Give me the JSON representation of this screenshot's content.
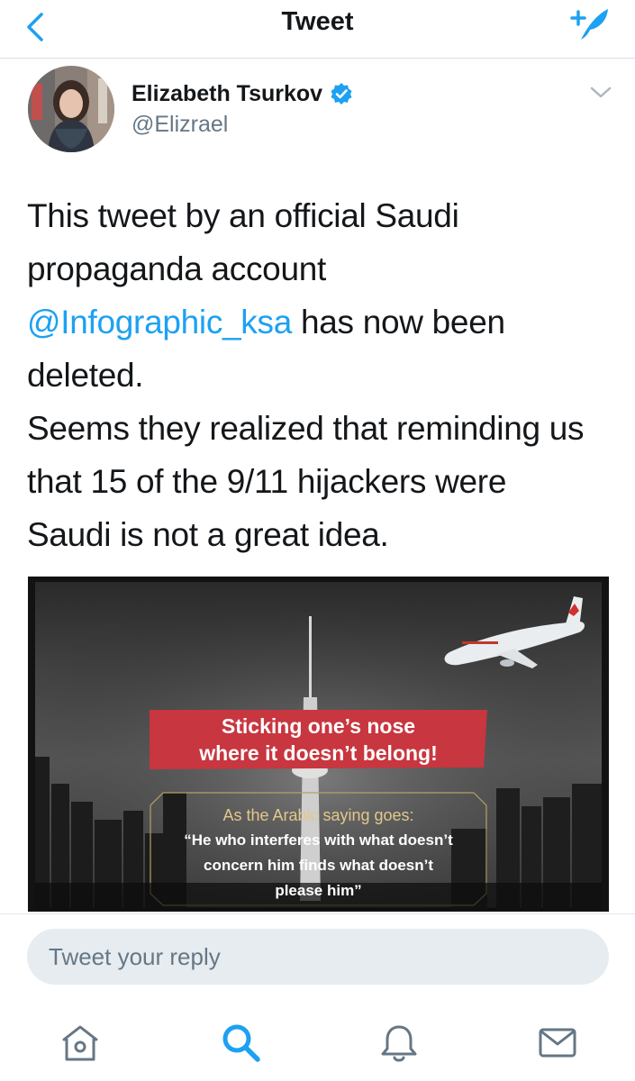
{
  "header": {
    "title": "Tweet",
    "back_icon": "chevron-left-icon",
    "compose_icon": "compose-tweet-icon",
    "accent": "#1da1f2"
  },
  "tweet": {
    "author_name": "Elizabeth Tsurkov",
    "handle": "@Elizrael",
    "verified": true,
    "lines": [
      {
        "text": "This tweet by an official Saudi"
      },
      {
        "text": "propaganda account"
      },
      {
        "mention": "@Infographic_ksa",
        "text": " has now been"
      },
      {
        "text": "deleted."
      },
      {
        "text": "Seems they realized that reminding us"
      },
      {
        "text": "that 15 of the 9/11 hijackers were"
      },
      {
        "text": "Saudi is not a great idea."
      }
    ]
  },
  "media": {
    "banner_line1": "Sticking one’s nose",
    "banner_line2": "where it doesn’t belong!",
    "saying_intro": "As the Arabic saying goes:",
    "quote_line1": "“He who interferes with what doesn’t",
    "quote_line2": "concern him finds what doesn’t",
    "quote_line3": "please him”",
    "banner_color": "#c8363f"
  },
  "reply": {
    "placeholder": "Tweet your reply"
  },
  "tabbar": {
    "items": [
      "home-icon",
      "search-icon",
      "notifications-icon",
      "messages-icon"
    ],
    "active": "search-icon"
  }
}
